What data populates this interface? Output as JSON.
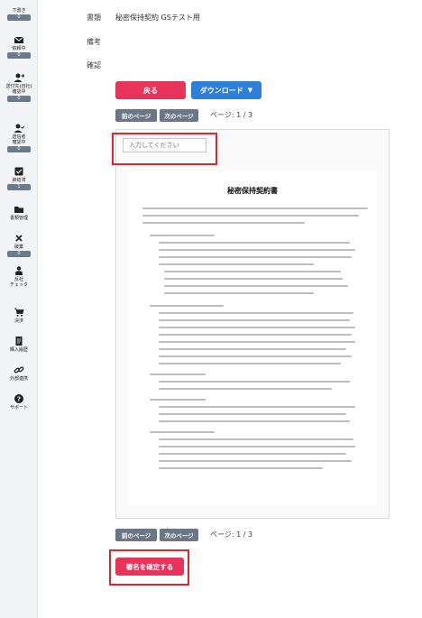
{
  "sidebar": {
    "items": [
      {
        "label": "下書き",
        "badge": "0",
        "icon": "edit-icon"
      },
      {
        "label": "依頼中",
        "badge": "0",
        "icon": "mail-icon"
      },
      {
        "label": "送付先(自社)\n確認中",
        "badge": "0",
        "icon": "user-send-icon"
      },
      {
        "label": "送信者\n確認中",
        "badge": "0",
        "icon": "user-check-icon"
      },
      {
        "label": "締結済",
        "badge": "1",
        "icon": "check-square-icon"
      },
      {
        "label": "書類管理",
        "badge": "",
        "icon": "folder-icon"
      },
      {
        "label": "破棄",
        "badge": "0",
        "icon": "x-icon"
      },
      {
        "label": "反社\nチェック",
        "badge": "",
        "icon": "shield-person-icon"
      },
      {
        "label": "決済",
        "badge": "",
        "icon": "cart-icon"
      },
      {
        "label": "購入履歴",
        "badge": "",
        "icon": "receipt-icon"
      },
      {
        "label": "外部連携",
        "badge": "",
        "icon": "link-icon"
      },
      {
        "label": "サポート",
        "badge": "",
        "icon": "question-icon"
      }
    ]
  },
  "fields": {
    "document_label": "書類",
    "document_value": "秘密保持契約 GSテスト用",
    "remarks_label": "備考",
    "confirm_label": "確認"
  },
  "actions": {
    "back": "戻る",
    "download": "ダウンロード",
    "prev_page": "前のページ",
    "next_page": "次のページ",
    "page_info": "ページ: 1 / 3",
    "confirm_signature": "署名を確定する"
  },
  "signature_input": {
    "placeholder": "入力してください"
  },
  "document": {
    "title": "秘密保持契約書"
  },
  "colors": {
    "primary_red": "#e8345a",
    "primary_blue": "#2e7fdb",
    "pager_gray": "#6b7785",
    "highlight_red": "#e3262c"
  }
}
